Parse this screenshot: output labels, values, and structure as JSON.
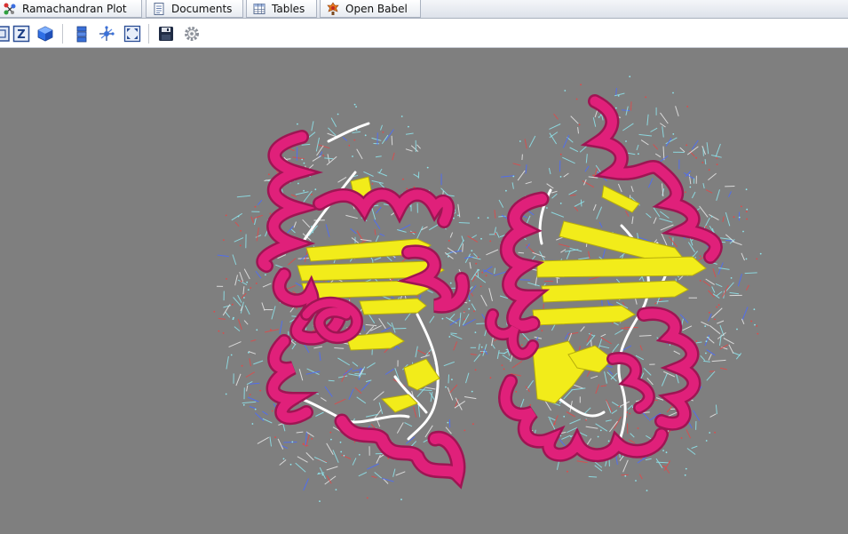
{
  "tabs": [
    {
      "label": "Ramachandran Plot",
      "icon": "ramachandran-plot-icon"
    },
    {
      "label": "Documents",
      "icon": "documents-icon"
    },
    {
      "label": "Tables",
      "icon": "tables-icon"
    },
    {
      "label": "Open Babel",
      "icon": "open-babel-icon"
    }
  ],
  "toolbar": {
    "buttons": [
      {
        "icon": "zoom-box-icon"
      },
      {
        "icon": "z-axis-icon"
      },
      {
        "icon": "cube-view-icon"
      },
      {
        "icon": "layers-icon"
      },
      {
        "icon": "molecule-center-icon"
      },
      {
        "icon": "fit-to-screen-icon"
      },
      {
        "icon": "save-icon"
      },
      {
        "icon": "settings-gear-icon"
      }
    ]
  },
  "viewer": {
    "background": "#7f7f7f",
    "colors": {
      "helix": "#e0207a",
      "helix_dark": "#9e1553",
      "sheet": "#f2ec1a",
      "sheet_dark": "#b7ad0c",
      "coil": "#ffffff",
      "atoms_carbon": "#8fe6ee",
      "atoms_nitrogen": "#4a6cff",
      "atoms_oxygen": "#e24848",
      "atoms_white": "#e9e9e9"
    }
  }
}
